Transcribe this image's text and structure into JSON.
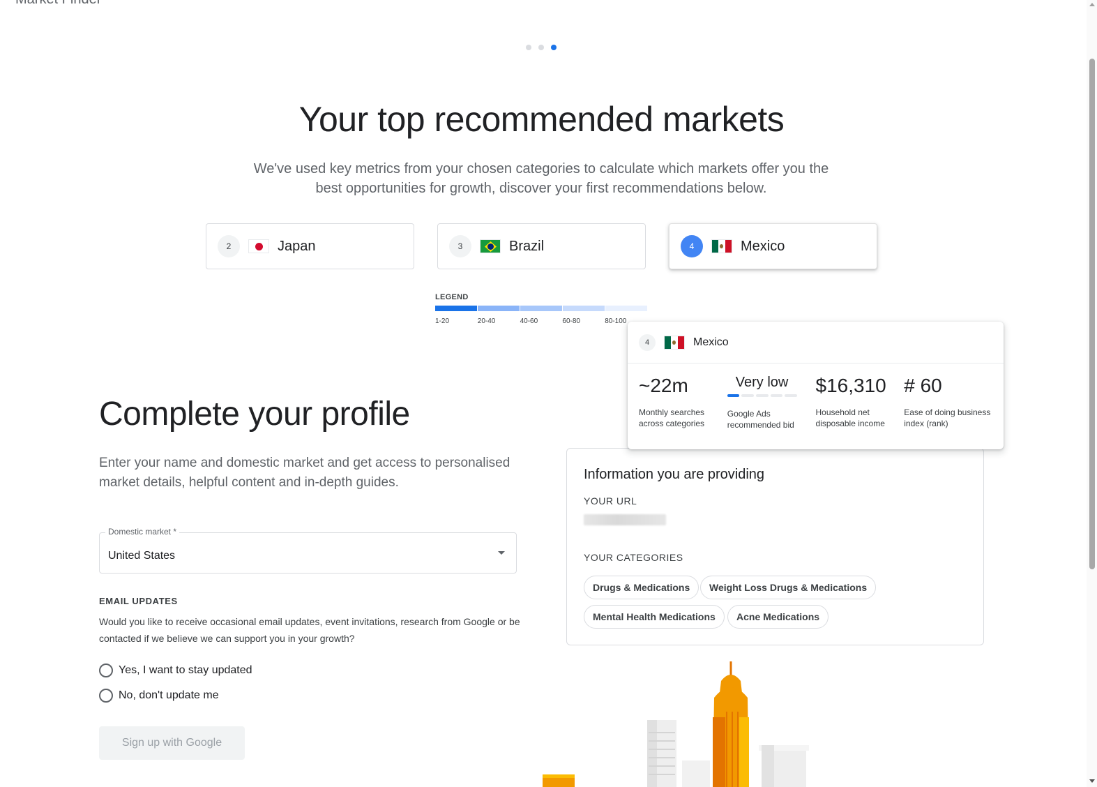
{
  "app": {
    "title": "Market Finder"
  },
  "stepper": {
    "total": 3,
    "current": 3
  },
  "hero": {
    "title": "Your top recommended markets",
    "subtitle": "We've used key metrics from your chosen categories to calculate which markets offer you the best opportunities for growth, discover your first recommendations below."
  },
  "markets": [
    {
      "rank": "2",
      "name": "Japan",
      "flag": "japan-flag-icon",
      "selected": false
    },
    {
      "rank": "3",
      "name": "Brazil",
      "flag": "brazil-flag-icon",
      "selected": false
    },
    {
      "rank": "4",
      "name": "Mexico",
      "flag": "mexico-flag-icon",
      "selected": true
    }
  ],
  "legend": {
    "title": "LEGEND",
    "ranges": [
      "1-20",
      "20-40",
      "40-60",
      "60-80",
      "80-100"
    ],
    "colors": [
      "#1a73e8",
      "#8ab4f8",
      "#a7c7fa",
      "#c6dafc",
      "#e8f0fe"
    ]
  },
  "detail": {
    "rank": "4",
    "country": "Mexico",
    "metrics": [
      {
        "value": "~22m",
        "label": "Monthly searches across categories"
      },
      {
        "value": "Very low",
        "label": "Google Ads recommended bid",
        "level": 1,
        "levels": 5
      },
      {
        "value": "$16,310",
        "label": "Household net disposable income"
      },
      {
        "value": "# 60",
        "label": "Ease of doing business index (rank)"
      }
    ]
  },
  "profile": {
    "title": "Complete your profile",
    "subtitle": "Enter your name and domestic market and get access to personalised market details, helpful content and in-depth guides.",
    "domestic_market_label": "Domestic market *",
    "domestic_market_value": "United States",
    "email_heading": "EMAIL UPDATES",
    "email_text": "Would you like to receive occasional email updates, event invitations, research from Google or be contacted if we believe we can support you in your growth?",
    "option_yes": "Yes, I want to stay updated",
    "option_no": "No, don't update me",
    "signup_label": "Sign up with Google"
  },
  "info": {
    "title": "Information you are providing",
    "url_label": "YOUR URL",
    "categories_label": "YOUR CATEGORIES",
    "categories": [
      "Drugs & Medications",
      "Weight Loss Drugs & Medications",
      "Mental Health Medications",
      "Acne Medications"
    ]
  },
  "colors": {
    "accent": "#1a73e8",
    "badge_active": "#4285f4",
    "building": "#f29900"
  }
}
